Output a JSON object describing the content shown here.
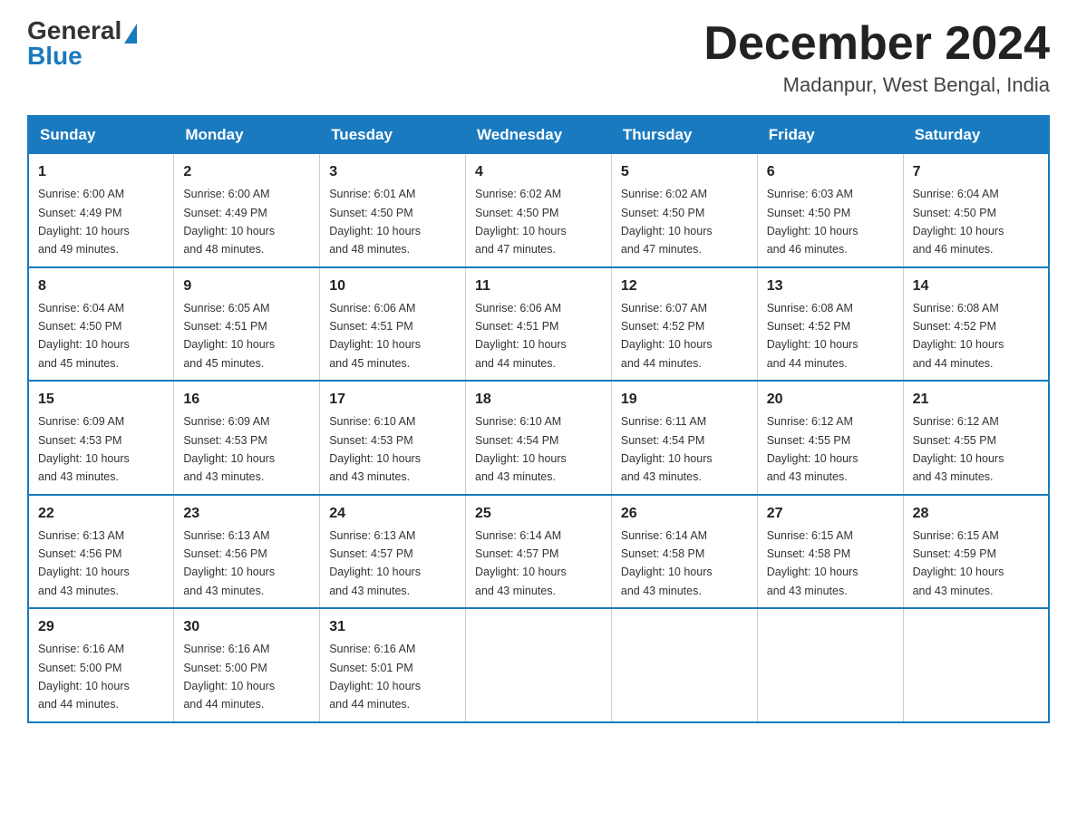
{
  "logo": {
    "general": "General",
    "blue": "Blue"
  },
  "title": "December 2024",
  "location": "Madanpur, West Bengal, India",
  "days_of_week": [
    "Sunday",
    "Monday",
    "Tuesday",
    "Wednesday",
    "Thursday",
    "Friday",
    "Saturday"
  ],
  "weeks": [
    [
      {
        "day": "1",
        "sunrise": "6:00 AM",
        "sunset": "4:49 PM",
        "daylight": "10 hours and 49 minutes."
      },
      {
        "day": "2",
        "sunrise": "6:00 AM",
        "sunset": "4:49 PM",
        "daylight": "10 hours and 48 minutes."
      },
      {
        "day": "3",
        "sunrise": "6:01 AM",
        "sunset": "4:50 PM",
        "daylight": "10 hours and 48 minutes."
      },
      {
        "day": "4",
        "sunrise": "6:02 AM",
        "sunset": "4:50 PM",
        "daylight": "10 hours and 47 minutes."
      },
      {
        "day": "5",
        "sunrise": "6:02 AM",
        "sunset": "4:50 PM",
        "daylight": "10 hours and 47 minutes."
      },
      {
        "day": "6",
        "sunrise": "6:03 AM",
        "sunset": "4:50 PM",
        "daylight": "10 hours and 46 minutes."
      },
      {
        "day": "7",
        "sunrise": "6:04 AM",
        "sunset": "4:50 PM",
        "daylight": "10 hours and 46 minutes."
      }
    ],
    [
      {
        "day": "8",
        "sunrise": "6:04 AM",
        "sunset": "4:50 PM",
        "daylight": "10 hours and 45 minutes."
      },
      {
        "day": "9",
        "sunrise": "6:05 AM",
        "sunset": "4:51 PM",
        "daylight": "10 hours and 45 minutes."
      },
      {
        "day": "10",
        "sunrise": "6:06 AM",
        "sunset": "4:51 PM",
        "daylight": "10 hours and 45 minutes."
      },
      {
        "day": "11",
        "sunrise": "6:06 AM",
        "sunset": "4:51 PM",
        "daylight": "10 hours and 44 minutes."
      },
      {
        "day": "12",
        "sunrise": "6:07 AM",
        "sunset": "4:52 PM",
        "daylight": "10 hours and 44 minutes."
      },
      {
        "day": "13",
        "sunrise": "6:08 AM",
        "sunset": "4:52 PM",
        "daylight": "10 hours and 44 minutes."
      },
      {
        "day": "14",
        "sunrise": "6:08 AM",
        "sunset": "4:52 PM",
        "daylight": "10 hours and 44 minutes."
      }
    ],
    [
      {
        "day": "15",
        "sunrise": "6:09 AM",
        "sunset": "4:53 PM",
        "daylight": "10 hours and 43 minutes."
      },
      {
        "day": "16",
        "sunrise": "6:09 AM",
        "sunset": "4:53 PM",
        "daylight": "10 hours and 43 minutes."
      },
      {
        "day": "17",
        "sunrise": "6:10 AM",
        "sunset": "4:53 PM",
        "daylight": "10 hours and 43 minutes."
      },
      {
        "day": "18",
        "sunrise": "6:10 AM",
        "sunset": "4:54 PM",
        "daylight": "10 hours and 43 minutes."
      },
      {
        "day": "19",
        "sunrise": "6:11 AM",
        "sunset": "4:54 PM",
        "daylight": "10 hours and 43 minutes."
      },
      {
        "day": "20",
        "sunrise": "6:12 AM",
        "sunset": "4:55 PM",
        "daylight": "10 hours and 43 minutes."
      },
      {
        "day": "21",
        "sunrise": "6:12 AM",
        "sunset": "4:55 PM",
        "daylight": "10 hours and 43 minutes."
      }
    ],
    [
      {
        "day": "22",
        "sunrise": "6:13 AM",
        "sunset": "4:56 PM",
        "daylight": "10 hours and 43 minutes."
      },
      {
        "day": "23",
        "sunrise": "6:13 AM",
        "sunset": "4:56 PM",
        "daylight": "10 hours and 43 minutes."
      },
      {
        "day": "24",
        "sunrise": "6:13 AM",
        "sunset": "4:57 PM",
        "daylight": "10 hours and 43 minutes."
      },
      {
        "day": "25",
        "sunrise": "6:14 AM",
        "sunset": "4:57 PM",
        "daylight": "10 hours and 43 minutes."
      },
      {
        "day": "26",
        "sunrise": "6:14 AM",
        "sunset": "4:58 PM",
        "daylight": "10 hours and 43 minutes."
      },
      {
        "day": "27",
        "sunrise": "6:15 AM",
        "sunset": "4:58 PM",
        "daylight": "10 hours and 43 minutes."
      },
      {
        "day": "28",
        "sunrise": "6:15 AM",
        "sunset": "4:59 PM",
        "daylight": "10 hours and 43 minutes."
      }
    ],
    [
      {
        "day": "29",
        "sunrise": "6:16 AM",
        "sunset": "5:00 PM",
        "daylight": "10 hours and 44 minutes."
      },
      {
        "day": "30",
        "sunrise": "6:16 AM",
        "sunset": "5:00 PM",
        "daylight": "10 hours and 44 minutes."
      },
      {
        "day": "31",
        "sunrise": "6:16 AM",
        "sunset": "5:01 PM",
        "daylight": "10 hours and 44 minutes."
      },
      null,
      null,
      null,
      null
    ]
  ],
  "labels": {
    "sunrise": "Sunrise:",
    "sunset": "Sunset:",
    "daylight": "Daylight:"
  }
}
